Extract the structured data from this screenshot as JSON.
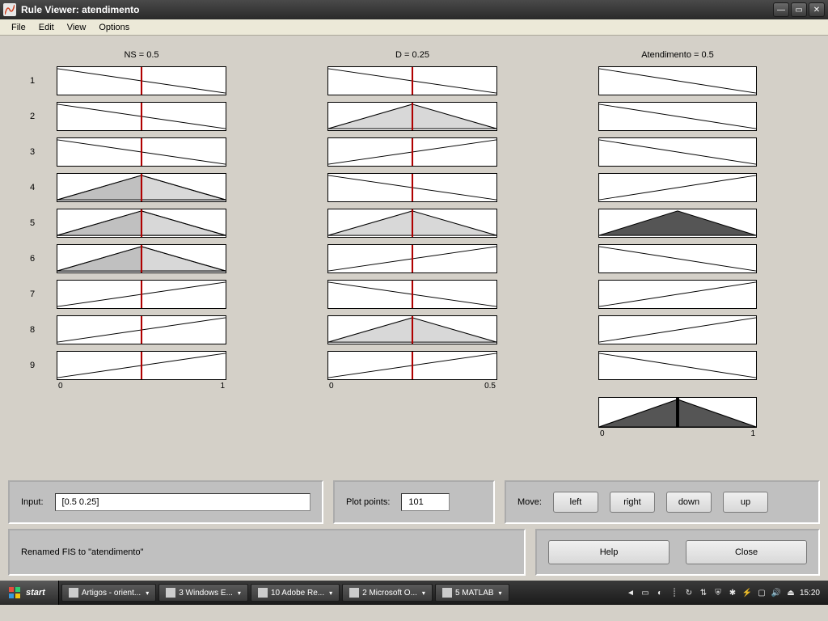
{
  "window": {
    "title": "Rule Viewer: atendimento"
  },
  "menu": {
    "file": "File",
    "edit": "Edit",
    "view": "View",
    "options": "Options"
  },
  "columns": {
    "ns": {
      "label": "NS = 0.5",
      "min": "0",
      "max": "1",
      "slider": 0.5
    },
    "d": {
      "label": "D = 0.25",
      "min": "0",
      "max": "0.5",
      "slider": 0.5
    },
    "out": {
      "label": "Atendimento = 0.5",
      "min": "0",
      "max": "1",
      "slider": 0.5
    }
  },
  "rules": [
    "1",
    "2",
    "3",
    "4",
    "5",
    "6",
    "7",
    "8",
    "9"
  ],
  "chart_data": {
    "type": "table",
    "note": "Fuzzy rule viewer: each cell is a membership function over [0,1] (D over [0,0.5]); shape one of desc-line, tri-center, tri-left-filled, asc-line. 'activated' shows rule firing.",
    "rows": [
      {
        "row": 1,
        "ns": "desc-line",
        "d": "desc-line",
        "out": "desc-line",
        "activated": false
      },
      {
        "row": 2,
        "ns": "desc-line",
        "d": "tri-center",
        "out": "desc-line",
        "activated": false
      },
      {
        "row": 3,
        "ns": "desc-line",
        "d": "asc-line",
        "out": "desc-line",
        "activated": false
      },
      {
        "row": 4,
        "ns": "tri-left-filled",
        "d": "desc-line",
        "out": "asc-line",
        "activated": false
      },
      {
        "row": 5,
        "ns": "tri-left-filled",
        "d": "tri-center",
        "out": "tri-center",
        "activated": true
      },
      {
        "row": 6,
        "ns": "tri-left-filled",
        "d": "asc-line",
        "out": "desc-line",
        "activated": false
      },
      {
        "row": 7,
        "ns": "asc-line",
        "d": "desc-line",
        "out": "asc-line",
        "activated": false
      },
      {
        "row": 8,
        "ns": "asc-line",
        "d": "tri-center",
        "out": "asc-line",
        "activated": false
      },
      {
        "row": 9,
        "ns": "asc-line",
        "d": "asc-line",
        "out": "desc-line",
        "activated": false
      }
    ],
    "aggregate_output": "tri-center-filled"
  },
  "controls": {
    "input_label": "Input:",
    "input_value": "[0.5 0.25]",
    "plotpoints_label": "Plot points:",
    "plotpoints_value": "101",
    "move_label": "Move:",
    "left": "left",
    "right": "right",
    "down": "down",
    "up": "up",
    "help": "Help",
    "close": "Close"
  },
  "status": {
    "message": "Renamed FIS to \"atendimento\""
  },
  "taskbar": {
    "start": "start",
    "items": [
      {
        "label": "Artigos - orient..."
      },
      {
        "label": "3 Windows E..."
      },
      {
        "label": "10 Adobe Re..."
      },
      {
        "label": "2 Microsoft O..."
      },
      {
        "label": "5 MATLAB"
      }
    ],
    "clock": "15:20"
  }
}
